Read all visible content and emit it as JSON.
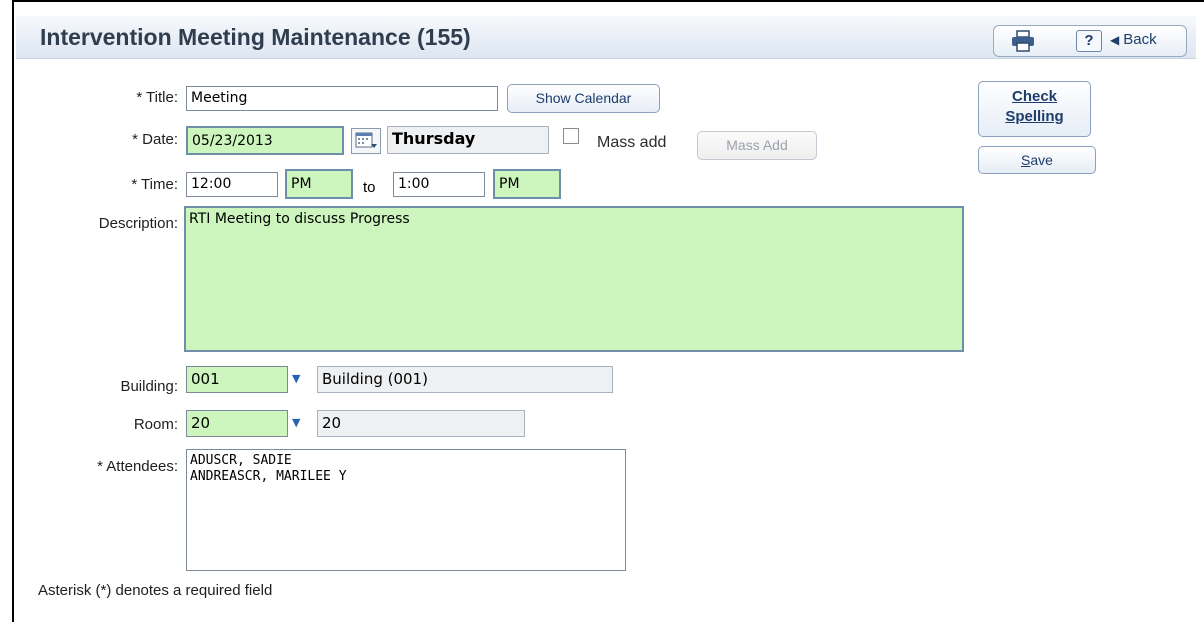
{
  "header": {
    "title": "Intervention Meeting Maintenance (155)",
    "help_label": "?",
    "back_label": "Back"
  },
  "actions": {
    "check_spelling_line1": "Check",
    "check_spelling_line2": "Spelling",
    "save_first": "S",
    "save_rest": "ave"
  },
  "form": {
    "title_label": "* Title:",
    "title_value": "Meeting",
    "show_calendar_label": "Show Calendar",
    "date_label": "* Date:",
    "date_value": "05/23/2013",
    "day_value": "Thursday",
    "mass_add_checkbox_label": "Mass add",
    "mass_add_button_label": "Mass Add",
    "time_label": "* Time:",
    "start_time": "12:00",
    "start_ampm": "PM",
    "to_label": "to",
    "end_time": "1:00",
    "end_ampm": "PM",
    "description_label": "Description:",
    "description_value": "RTI Meeting to discuss Progress",
    "building_label": "Building:",
    "building_code": "001",
    "building_name": "Building (001)",
    "room_label": "Room:",
    "room_code": "20",
    "room_name": "20",
    "attendees_label": "* Attendees:",
    "attendees": [
      "ADUSCR, SADIE",
      "ANDREASCR, MARILEE Y"
    ],
    "required_note": "Asterisk (*) denotes a required field"
  },
  "colors": {
    "required_bg": "#ccf6bd",
    "title_text": "#2f3d4f",
    "link_blue": "#1e3d6b"
  },
  "icons": [
    "printer-icon",
    "help-icon",
    "back-arrow-icon",
    "calendar-icon",
    "dropdown-caret-icon"
  ]
}
